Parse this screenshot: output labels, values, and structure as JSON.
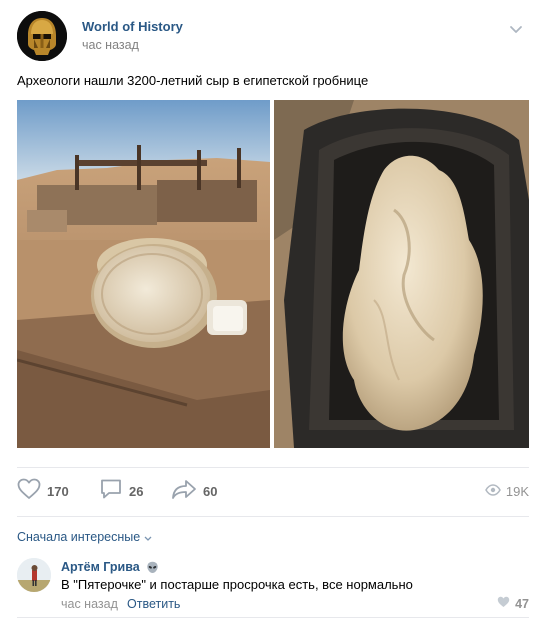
{
  "post": {
    "author": "World of History",
    "time": "час назад",
    "text": "Археологи нашли 3200-летний сыр в египетской гробнице",
    "photos": [
      "excavation-cheese-photo",
      "cheese-closeup-photo"
    ]
  },
  "actions": {
    "likes": "170",
    "comments": "26",
    "shares": "60",
    "views": "19K"
  },
  "comments": {
    "sort_label": "Сначала интересные",
    "items": [
      {
        "author": "Артём Грива",
        "badge_icon": "alien-icon",
        "text": "В \"Пятерочке\" и постарше просрочка есть, все нормально",
        "time": "час назад",
        "reply_label": "Ответить",
        "likes": "47"
      }
    ]
  },
  "colors": {
    "link": "#2a5885",
    "muted": "#939393",
    "divider": "#e7e8ec"
  }
}
